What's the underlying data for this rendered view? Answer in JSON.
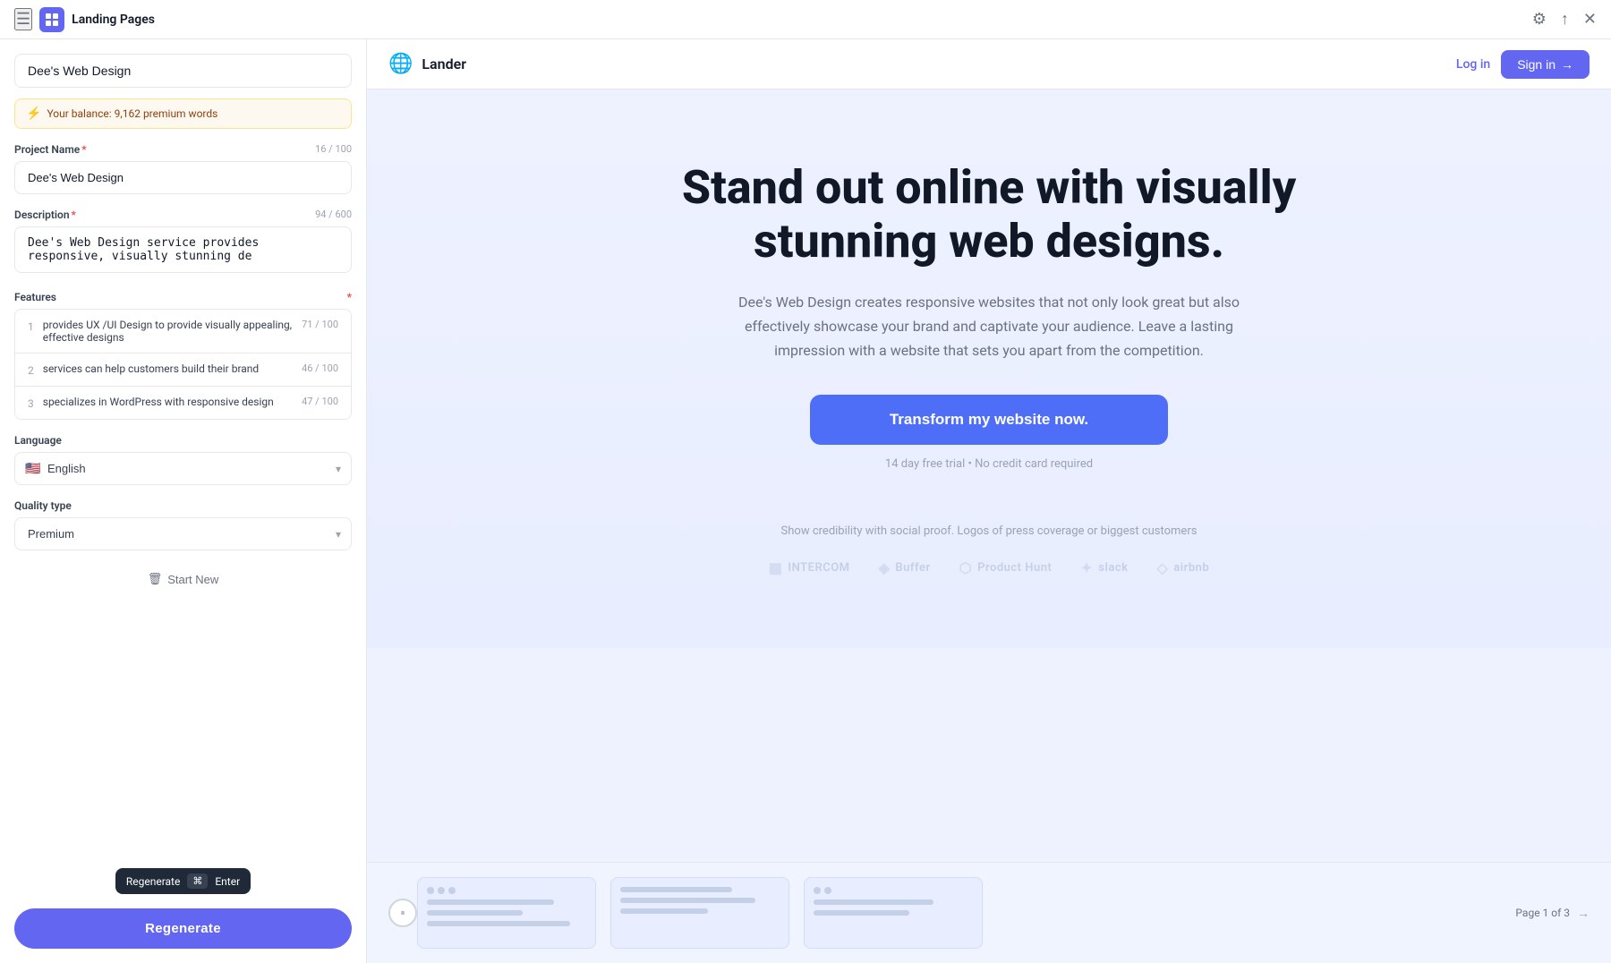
{
  "titleBar": {
    "title": "Landing Pages",
    "menuIcon": "☰",
    "settingsIcon": "⚙",
    "shareIcon": "↑",
    "closeIcon": "✕"
  },
  "leftPanel": {
    "projectNameDisplay": "Dee's Web Design",
    "balance": {
      "icon": "⚡",
      "text": "Your balance: 9,162 premium words"
    },
    "projectNameField": {
      "label": "Project Name",
      "required": true,
      "counter": "16 / 100",
      "value": "Dee's Web Design"
    },
    "descriptionField": {
      "label": "Description",
      "required": true,
      "counter": "94 / 600",
      "value": "Dee's Web Design service provides responsive, visually stunning de"
    },
    "featuresField": {
      "label": "Features",
      "required": true,
      "items": [
        {
          "num": "1",
          "text": "provides UX /UI Design to provide visually appealing, effective designs",
          "counter": "71 / 100"
        },
        {
          "num": "2",
          "text": "services can help customers build their brand",
          "counter": "46 / 100"
        },
        {
          "num": "3",
          "text": "specializes in WordPress with responsive design",
          "counter": "47 / 100"
        }
      ]
    },
    "languageField": {
      "label": "Language",
      "value": "English",
      "flag": "🇺🇸"
    },
    "qualityField": {
      "label": "Quality type",
      "value": "Premium"
    },
    "startNewBtn": "Start New",
    "tooltip": {
      "label": "Regenerate",
      "cmdIcon": "⌘",
      "enterKey": "Enter"
    },
    "regenerateBtn": "Regenerate"
  },
  "preview": {
    "header": {
      "globe": "🌐",
      "brandName": "Lander",
      "loginLabel": "Log in",
      "signinLabel": "Sign in",
      "signinArrow": "→"
    },
    "hero": {
      "title": "Stand out online with visually stunning web designs.",
      "subtitle": "Dee's Web Design creates responsive websites that not only look great but also effectively showcase your brand and captivate your audience. Leave a lasting impression with a website that sets you apart from the competition.",
      "ctaLabel": "Transform my website now.",
      "note": "14 day free trial • No credit card required",
      "socialProofText": "Show credibility with social proof. Logos of press coverage or biggest customers",
      "logos": [
        {
          "icon": "▦",
          "name": "INTERCOM"
        },
        {
          "icon": "◈",
          "name": "Buffer"
        },
        {
          "icon": "⬡",
          "name": "Product Hunt"
        },
        {
          "icon": "✦",
          "name": "slack"
        },
        {
          "icon": "◇",
          "name": "airbnb"
        }
      ]
    },
    "pagination": {
      "label": "Page 1 of 3",
      "arrow": "→"
    }
  }
}
